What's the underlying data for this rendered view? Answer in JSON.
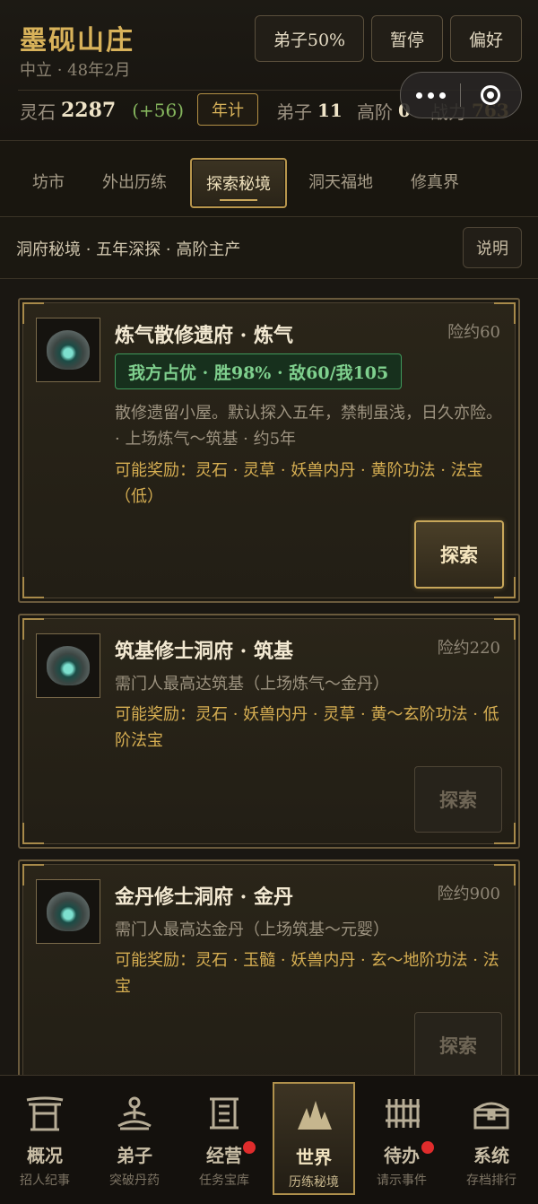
{
  "header": {
    "title": "墨砚山庄",
    "subtitle": "中立 · 48年2月",
    "buttons": {
      "disciples": "弟子50%",
      "pause": "暂停",
      "prefs": "偏好"
    },
    "stats": {
      "spirit_stone_label": "灵石",
      "spirit_stone_value": "2287",
      "spirit_stone_delta": "(+56)",
      "year_btn": "年计",
      "disciples_label": "弟子",
      "disciples_value": "11",
      "high_rank_label": "高阶",
      "high_rank_value": "0",
      "power_label": "战力",
      "power_value": "763"
    }
  },
  "tabs": [
    {
      "label": "坊市"
    },
    {
      "label": "外出历练"
    },
    {
      "label": "探索秘境",
      "active": true
    },
    {
      "label": "洞天福地"
    },
    {
      "label": "修真界"
    }
  ],
  "info": {
    "text": "洞府秘境 · 五年深探 · 高阶主产",
    "explain_btn": "说明"
  },
  "cards": [
    {
      "title": "炼气散修遗府 · 炼气",
      "risk": "险约60",
      "advantage": "我方占优 · 胜98% · 敌60/我105",
      "desc": "散修遗留小屋。默认探入五年，禁制虽浅，日久亦险。 · 上场炼气～筑基 · 约5年",
      "reward": "可能奖励：灵石 · 灵草 · 妖兽内丹 · 黄阶功法 · 法宝（低）",
      "button": "探索"
    },
    {
      "title": "筑基修士洞府 · 筑基",
      "risk": "险约220",
      "desc": "需门人最高达筑基（上场炼气～金丹）",
      "reward": "可能奖励：灵石 · 妖兽内丹 · 灵草 · 黄～玄阶功法 · 低阶法宝",
      "button": "探索"
    },
    {
      "title": "金丹修士洞府 · 金丹",
      "risk": "险约900",
      "desc": "需门人最高达金丹（上场筑基～元婴）",
      "reward": "可能奖励：灵石 · 玉髓 · 妖兽内丹 · 玄～地阶功法 · 法宝",
      "button": "探索"
    }
  ],
  "nav": [
    {
      "main": "概况",
      "sub": "招人纪事",
      "icon": "gate-icon"
    },
    {
      "main": "弟子",
      "sub": "突破丹药",
      "icon": "meditation-icon"
    },
    {
      "main": "经营",
      "sub": "任务宝库",
      "icon": "scroll-icon"
    },
    {
      "main": "世界",
      "sub": "历练秘境",
      "icon": "mountain-icon"
    },
    {
      "main": "待办",
      "sub": "请示事件",
      "icon": "bamboo-slips-icon"
    },
    {
      "main": "系统",
      "sub": "存档排行",
      "icon": "chest-icon"
    }
  ],
  "colors": {
    "gold": "#d8b25a",
    "green": "#7fd08e",
    "red_badge": "#e02c2c"
  }
}
